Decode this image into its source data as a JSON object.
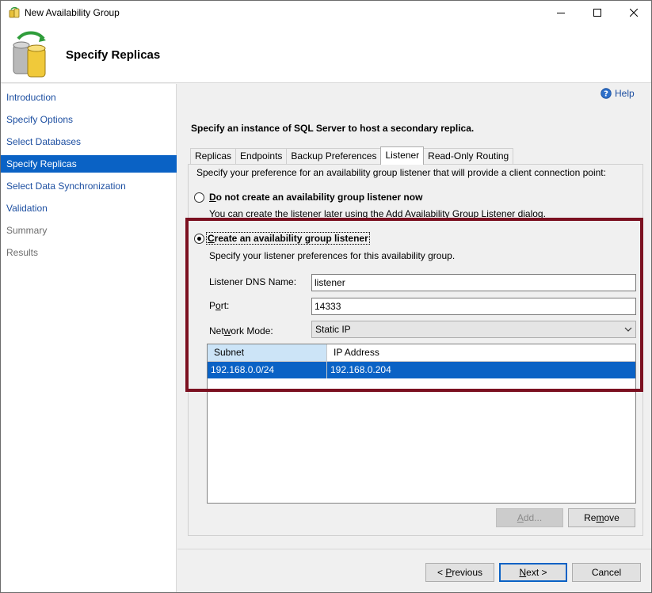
{
  "window": {
    "title": "New Availability Group"
  },
  "header": {
    "title": "Specify Replicas"
  },
  "sidebar": {
    "items": [
      {
        "label": "Introduction",
        "state": "link"
      },
      {
        "label": "Specify Options",
        "state": "link"
      },
      {
        "label": "Select Databases",
        "state": "link"
      },
      {
        "label": "Specify Replicas",
        "state": "active"
      },
      {
        "label": "Select Data Synchronization",
        "state": "link"
      },
      {
        "label": "Validation",
        "state": "link"
      },
      {
        "label": "Summary",
        "state": "disabled"
      },
      {
        "label": "Results",
        "state": "disabled"
      }
    ]
  },
  "help": {
    "label": "Help"
  },
  "instruction": "Specify an instance of SQL Server to host a secondary replica.",
  "tabs": [
    {
      "label": "Replicas",
      "active": false
    },
    {
      "label": "Endpoints",
      "active": false
    },
    {
      "label": "Backup Preferences",
      "active": false
    },
    {
      "label": "Listener",
      "active": true
    },
    {
      "label": "Read-Only Routing",
      "active": false
    }
  ],
  "listener": {
    "intro": "Specify your preference for an availability group listener that will provide a client connection point:",
    "option_no": {
      "label_mnemonic": "D",
      "label_rest": "o not create an availability group listener now",
      "help": "You can create the listener later using the Add Availability Group Listener dialog.",
      "checked": false
    },
    "option_create": {
      "label_mnemonic": "C",
      "label_rest": "reate an availability group listener",
      "help": "Specify your listener preferences for this availability group.",
      "checked": true
    },
    "dns_name": {
      "label": "Listener DNS Name:",
      "value": "listener"
    },
    "port": {
      "label_pre": "P",
      "label_mnemonic": "o",
      "label_post": "rt:",
      "value": "14333"
    },
    "network_mode": {
      "label_pre": "Net",
      "label_mnemonic": "w",
      "label_post": "ork Mode:",
      "value": "Static IP"
    },
    "grid": {
      "columns": [
        "Subnet",
        "IP Address"
      ],
      "rows": [
        {
          "subnet": "192.168.0.0/24",
          "ip": "192.168.0.204"
        }
      ]
    },
    "add_button": {
      "label_mnemonic": "A",
      "label_rest": "dd..."
    },
    "remove_button": {
      "label_pre": "Re",
      "label_mnemonic": "m",
      "label_post": "ove"
    }
  },
  "footer": {
    "previous": {
      "pre": "< ",
      "mnemonic": "P",
      "post": "revious"
    },
    "next": {
      "mnemonic": "N",
      "post": "ext >"
    },
    "cancel": "Cancel"
  },
  "colors": {
    "accent": "#0a62c5",
    "link": "#1d4fa1",
    "highlight_border": "#7b1020"
  }
}
